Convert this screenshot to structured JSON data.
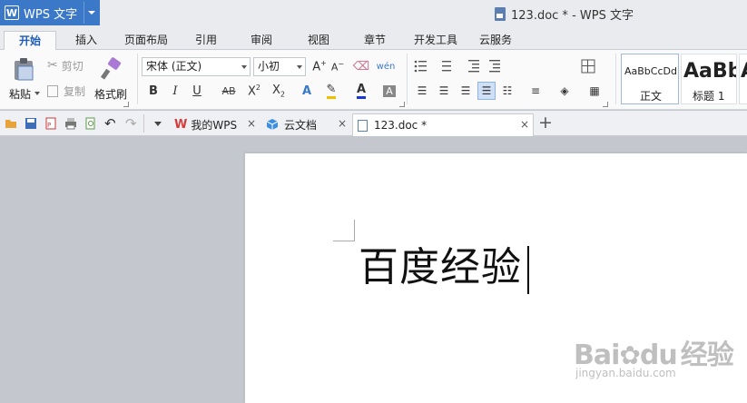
{
  "app": {
    "name": "WPS 文字",
    "logo": "W",
    "document_title": "123.doc * - WPS 文字"
  },
  "menu_tabs": [
    "开始",
    "插入",
    "页面布局",
    "引用",
    "审阅",
    "视图",
    "章节",
    "开发工具",
    "云服务"
  ],
  "ribbon": {
    "clipboard": {
      "paste": "粘贴",
      "cut": "剪切",
      "copy": "复制",
      "format_painter": "格式刷"
    },
    "font": {
      "name": "宋体 (正文)",
      "size": "小初"
    },
    "styles": [
      {
        "preview": "AaBbCcDd",
        "label": "正文"
      },
      {
        "preview": "AaBb",
        "label": "标题 1"
      },
      {
        "preview": "A",
        "label": ""
      }
    ],
    "colors": {
      "font_color": "#1a36d6",
      "highlight": "#f0c000",
      "accent": "#3c78c8"
    }
  },
  "tabs": [
    {
      "label": "我的WPS",
      "icon": "wps-logo-icon"
    },
    {
      "label": "云文档",
      "icon": "cloud-cube-icon"
    },
    {
      "label": "123.doc *",
      "icon": "doc-icon",
      "active": true
    }
  ],
  "document": {
    "text": "百度经验"
  },
  "watermark": {
    "brand": "Bai",
    "brand2": "du",
    "brand3": "经验",
    "url": "jingyan.baidu.com"
  }
}
